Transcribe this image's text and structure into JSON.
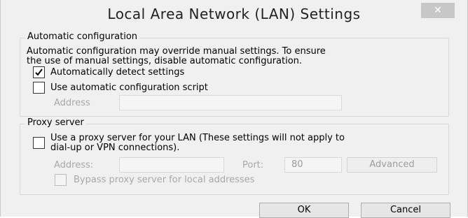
{
  "window": {
    "title": "Local Area Network (LAN) Settings",
    "close_glyph": "✕"
  },
  "auto_config": {
    "group_label": "Automatic configuration",
    "description_line1": "Automatic configuration may override manual settings.  To ensure",
    "description_line2": "the use of manual settings, disable automatic configuration.",
    "detect_settings_label": "Automatically detect settings",
    "detect_settings_checked": true,
    "use_script_label": "Use automatic configuration script",
    "use_script_checked": false,
    "address_label": "Address",
    "address_value": ""
  },
  "proxy": {
    "group_label": "Proxy server",
    "use_proxy_line1": "Use a proxy server for your LAN (These settings will not apply to",
    "use_proxy_line2": "dial-up or VPN connections).",
    "use_proxy_checked": false,
    "address_label": "Address:",
    "address_value": "",
    "port_label": "Port:",
    "port_value": "80",
    "advanced_label": "Advanced",
    "bypass_label": "Bypass proxy server for local addresses",
    "bypass_checked": false
  },
  "footer": {
    "ok_label": "OK",
    "cancel_label": "Cancel"
  },
  "icons": {
    "check": "check-icon",
    "close": "close-icon"
  }
}
